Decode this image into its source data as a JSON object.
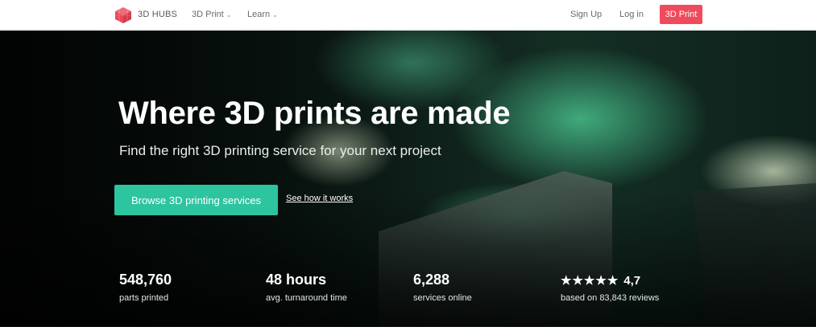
{
  "navbar": {
    "brand": "3D HUBS",
    "menu": [
      {
        "label": "3D Print",
        "has_dropdown": true
      },
      {
        "label": "Learn",
        "has_dropdown": true
      }
    ],
    "sign_up": "Sign Up",
    "log_in": "Log in",
    "cta": "3D Print",
    "caret": "⌄"
  },
  "hero": {
    "title": "Where 3D prints are made",
    "subtitle": "Find the right 3D printing service for your next project",
    "primary_button": "Browse 3D printing services",
    "secondary_link": "See how it works"
  },
  "stats": [
    {
      "value": "548,760",
      "label": "parts printed"
    },
    {
      "value": "48 hours",
      "label": "avg. turnaround time"
    },
    {
      "value": "6,288",
      "label": "services online"
    }
  ],
  "rating": {
    "star_glyph": "★",
    "stars": 5,
    "value": "4,7",
    "label": "based on 83,843 reviews"
  },
  "colors": {
    "brand_red": "#ef4b5c",
    "accent_green": "#2cc5a0"
  }
}
